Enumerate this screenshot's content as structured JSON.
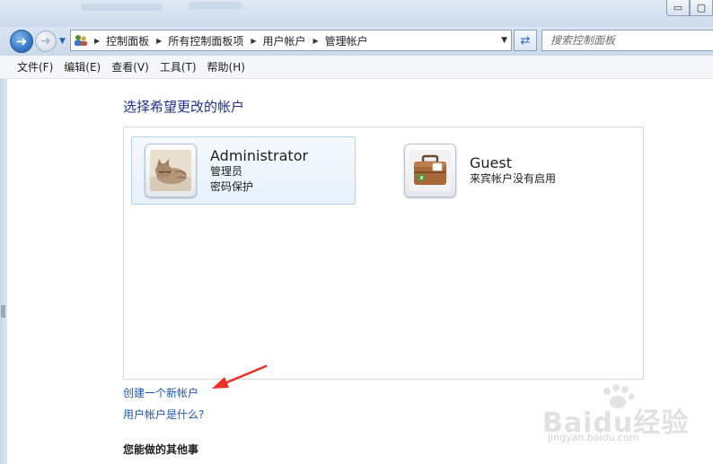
{
  "window": {
    "minimize_label": "▭",
    "maximize_label": "▢"
  },
  "address_bar": {
    "breadcrumbs": [
      "控制面板",
      "所有控制面板项",
      "用户帐户",
      "管理帐户"
    ]
  },
  "search": {
    "placeholder": "搜索控制面板"
  },
  "menu": {
    "items": [
      "文件(F)",
      "编辑(E)",
      "查看(V)",
      "工具(T)",
      "帮助(H)"
    ]
  },
  "main": {
    "heading": "选择希望更改的帐户",
    "accounts": [
      {
        "name": "Administrator",
        "line1": "管理员",
        "line2": "密码保护",
        "icon": "cat-avatar"
      },
      {
        "name": "Guest",
        "line1": "来宾帐户没有启用",
        "icon": "suitcase-avatar"
      }
    ],
    "links": {
      "create_account": "创建一个新帐户",
      "what_is_account": "用户帐户是什么?"
    },
    "other_things": "您能做的其他事"
  },
  "watermark": {
    "brand": "Baidu经验",
    "url": "jingyan.baidu.com"
  },
  "colors": {
    "heading": "#1e3287",
    "link": "#1e55b0",
    "annotation_arrow": "#e8322a"
  }
}
